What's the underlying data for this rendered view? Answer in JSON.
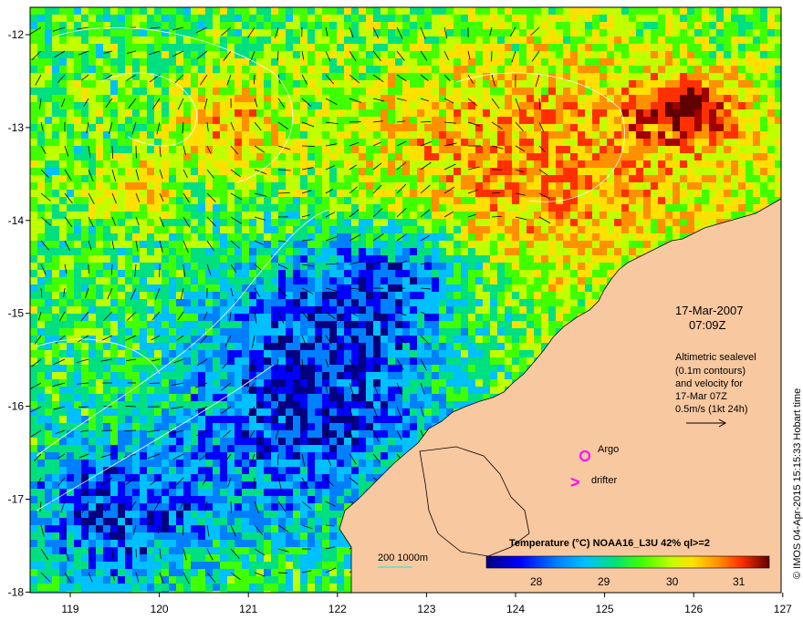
{
  "map": {
    "date_line": "17-Mar-2007",
    "time_line": "07:09Z",
    "info_lines": [
      "Altimetric sealevel",
      "(0.1m contours)",
      "and velocity for",
      "17-Mar 07Z",
      "0.5m/s (1kt 24h)"
    ],
    "legend": {
      "argo_label": "Argo",
      "drifter_label": "drifter",
      "drifter_symbol": ">",
      "argo_color": "#ff00ff",
      "drifter_color": "#ff00ff"
    },
    "bathymetry_label": "200  1000m",
    "colorbar": {
      "title": "Temperature (°C) NOAA16_L3U 42% ql>=2",
      "ticks": [
        "28",
        "29",
        "30",
        "31"
      ]
    },
    "credit": "© IMOS 04-Apr-2015 15:15:33 Hobart time",
    "axes": {
      "x_ticks": [
        "119",
        "120",
        "121",
        "122",
        "123",
        "124",
        "125",
        "126",
        "127"
      ],
      "y_ticks": [
        "-12",
        "-13",
        "-14",
        "-15",
        "-16",
        "-17",
        "-18"
      ]
    },
    "colors": {
      "land": "#f8c8a0",
      "sst_scale": [
        "#000080",
        "#0000ff",
        "#0080ff",
        "#00c0ff",
        "#00e080",
        "#40ff00",
        "#c0ff00",
        "#ffe000",
        "#ff9000",
        "#ff3000",
        "#a00000",
        "#600000"
      ]
    }
  }
}
